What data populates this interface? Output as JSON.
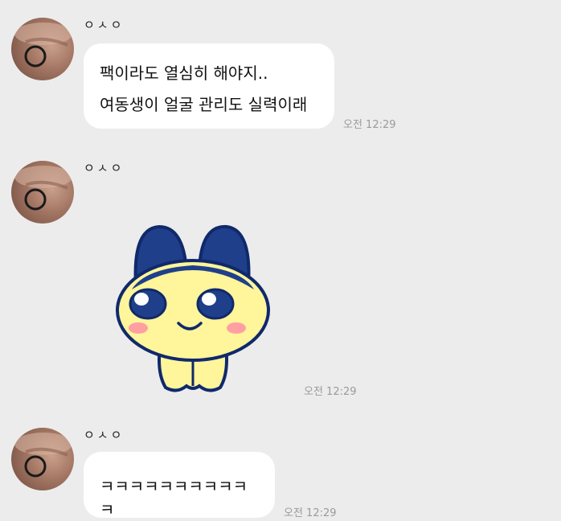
{
  "messages": [
    {
      "sender": "ㅇㅅㅇ",
      "avatar_icon": "profile-photo",
      "lines": [
        "팩이라도 열심히 해야지..",
        "여동생이 얼굴 관리도 실력이래"
      ],
      "time": "오전 12:29"
    },
    {
      "sender": "ㅇㅅㅇ",
      "avatar_icon": "profile-photo",
      "sticker_icon": "mametchi-character-sticker",
      "time": "오전 12:29"
    },
    {
      "sender": "ㅇㅅㅇ",
      "avatar_icon": "profile-photo",
      "lines": [
        "ㅋㅋㅋㅋㅋㅋㅋㅋㅋㅋㅋ"
      ],
      "time": "오전 12:29"
    }
  ],
  "colors": {
    "background": "#ececec",
    "bubble": "#ffffff",
    "time_text": "#9a9a9a",
    "sticker_navy": "#1f3f8a",
    "sticker_yellow": "#fff59a"
  }
}
